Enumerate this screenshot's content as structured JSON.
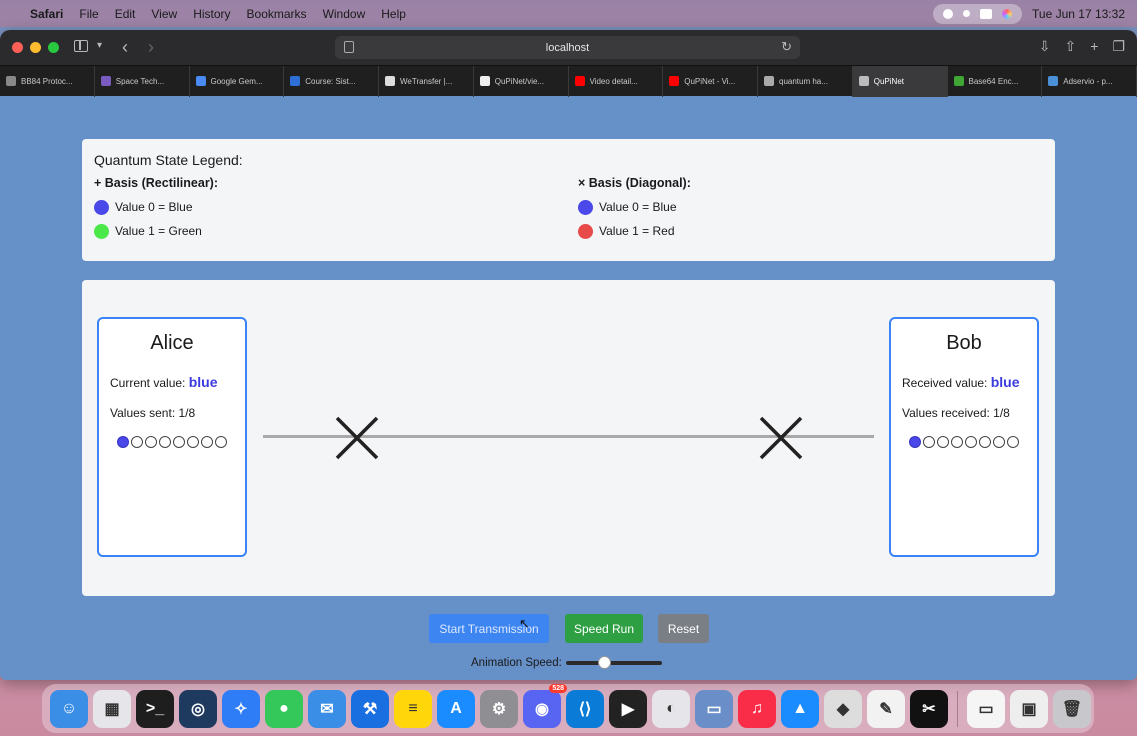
{
  "menubar": {
    "apple_icon": "apple-logo-icon",
    "app_name": "Safari",
    "items": [
      "File",
      "Edit",
      "View",
      "History",
      "Bookmarks",
      "Window",
      "Help"
    ],
    "datetime": "Tue Jun 17  13:32"
  },
  "browser": {
    "address": "localhost",
    "tabs": [
      {
        "label": "BB84 Protoc...",
        "color": "#888888"
      },
      {
        "label": "Space Tech...",
        "color": "#7a5cc0"
      },
      {
        "label": "Google Gem...",
        "color": "#4a8af4"
      },
      {
        "label": "Course: Sist...",
        "color": "#2d6fd6"
      },
      {
        "label": "WeTransfer |...",
        "color": "#dddddd"
      },
      {
        "label": "QuPiNet/vie...",
        "color": "#eeeeee"
      },
      {
        "label": "Video detail...",
        "color": "#ff0000"
      },
      {
        "label": "QuPiNet - Vi...",
        "color": "#ff0000"
      },
      {
        "label": "quantum ha...",
        "color": "#aaaaaa"
      },
      {
        "label": "QuPiNet",
        "color": "#bbbbbb",
        "active": true
      },
      {
        "label": "Base64 Enc...",
        "color": "#3fa535"
      },
      {
        "label": "Adservio - p...",
        "color": "#4a90d9"
      }
    ]
  },
  "legend": {
    "title": "Quantum State Legend:",
    "rect": {
      "heading": "+ Basis (Rectilinear):",
      "v0": "Value 0 = Blue",
      "v1": "Value 1 = Green"
    },
    "diag": {
      "heading": "× Basis (Diagonal):",
      "v0": "Value 0 = Blue",
      "v1": "Value 1 = Red"
    }
  },
  "alice": {
    "name": "Alice",
    "current_label": "Current value:",
    "current_value": "blue",
    "sent_text": "Values sent: 1/8",
    "sent": 1,
    "total": 8
  },
  "bob": {
    "name": "Bob",
    "received_label": "Received value:",
    "received_value": "blue",
    "received_text": "Values received: 1/8",
    "received": 1,
    "total": 8
  },
  "controls": {
    "start": "Start Transmission",
    "speed_run": "Speed Run",
    "reset": "Reset",
    "speed_label": "Animation Speed:",
    "speed_level": 0.4
  },
  "colors": {
    "blue": "#4a48e8",
    "green": "#4be84a",
    "red": "#e84a4a",
    "accent": "#3b82f6"
  },
  "dock": [
    {
      "name": "finder-icon",
      "color": "#3a8ee6",
      "glyph": "☺"
    },
    {
      "name": "launchpad-icon",
      "color": "#e5e5ea",
      "glyph": "▦"
    },
    {
      "name": "terminal-icon",
      "color": "#1e1e1e",
      "glyph": ">_"
    },
    {
      "name": "app-icon",
      "color": "#1f3a5f",
      "glyph": "◎"
    },
    {
      "name": "safari-icon",
      "color": "#2f7df6",
      "glyph": "✧"
    },
    {
      "name": "messages-icon",
      "color": "#34c759",
      "glyph": "●"
    },
    {
      "name": "mail-icon",
      "color": "#3a8ee6",
      "glyph": "✉"
    },
    {
      "name": "xcode-icon",
      "color": "#1a6fe0",
      "glyph": "⚒"
    },
    {
      "name": "notes-icon",
      "color": "#ffd60a",
      "glyph": "≡"
    },
    {
      "name": "app-store-icon",
      "color": "#1a8cff",
      "glyph": "A"
    },
    {
      "name": "system-settings-icon",
      "color": "#8e8e93",
      "glyph": "⚙"
    },
    {
      "name": "discord-icon",
      "color": "#5865f2",
      "glyph": "◉",
      "badge": "528"
    },
    {
      "name": "vscode-icon",
      "color": "#0a7bd6",
      "glyph": "⟨⟩"
    },
    {
      "name": "app-icon",
      "color": "#222222",
      "glyph": "▶"
    },
    {
      "name": "app-icon",
      "color": "#e5e5ea",
      "glyph": "◐"
    },
    {
      "name": "preview-icon",
      "color": "#6a8fc8",
      "glyph": "▭"
    },
    {
      "name": "music-icon",
      "color": "#fa2d48",
      "glyph": "♫"
    },
    {
      "name": "keynote-icon",
      "color": "#1a8cff",
      "glyph": "▲"
    },
    {
      "name": "inkscape-icon",
      "color": "#dddddd",
      "glyph": "◆"
    },
    {
      "name": "textedit-icon",
      "color": "#f2f2f2",
      "glyph": "✎"
    },
    {
      "name": "capcut-icon",
      "color": "#111111",
      "glyph": "✂"
    },
    {
      "name": "separator",
      "color": "",
      "glyph": ""
    },
    {
      "name": "window-thumbnail-icon",
      "color": "#f5f5f5",
      "glyph": "▭"
    },
    {
      "name": "window-thumbnail-icon",
      "color": "#eeeeee",
      "glyph": "▣"
    },
    {
      "name": "trash-icon",
      "color": "#c8c8cc",
      "glyph": "🗑"
    }
  ]
}
